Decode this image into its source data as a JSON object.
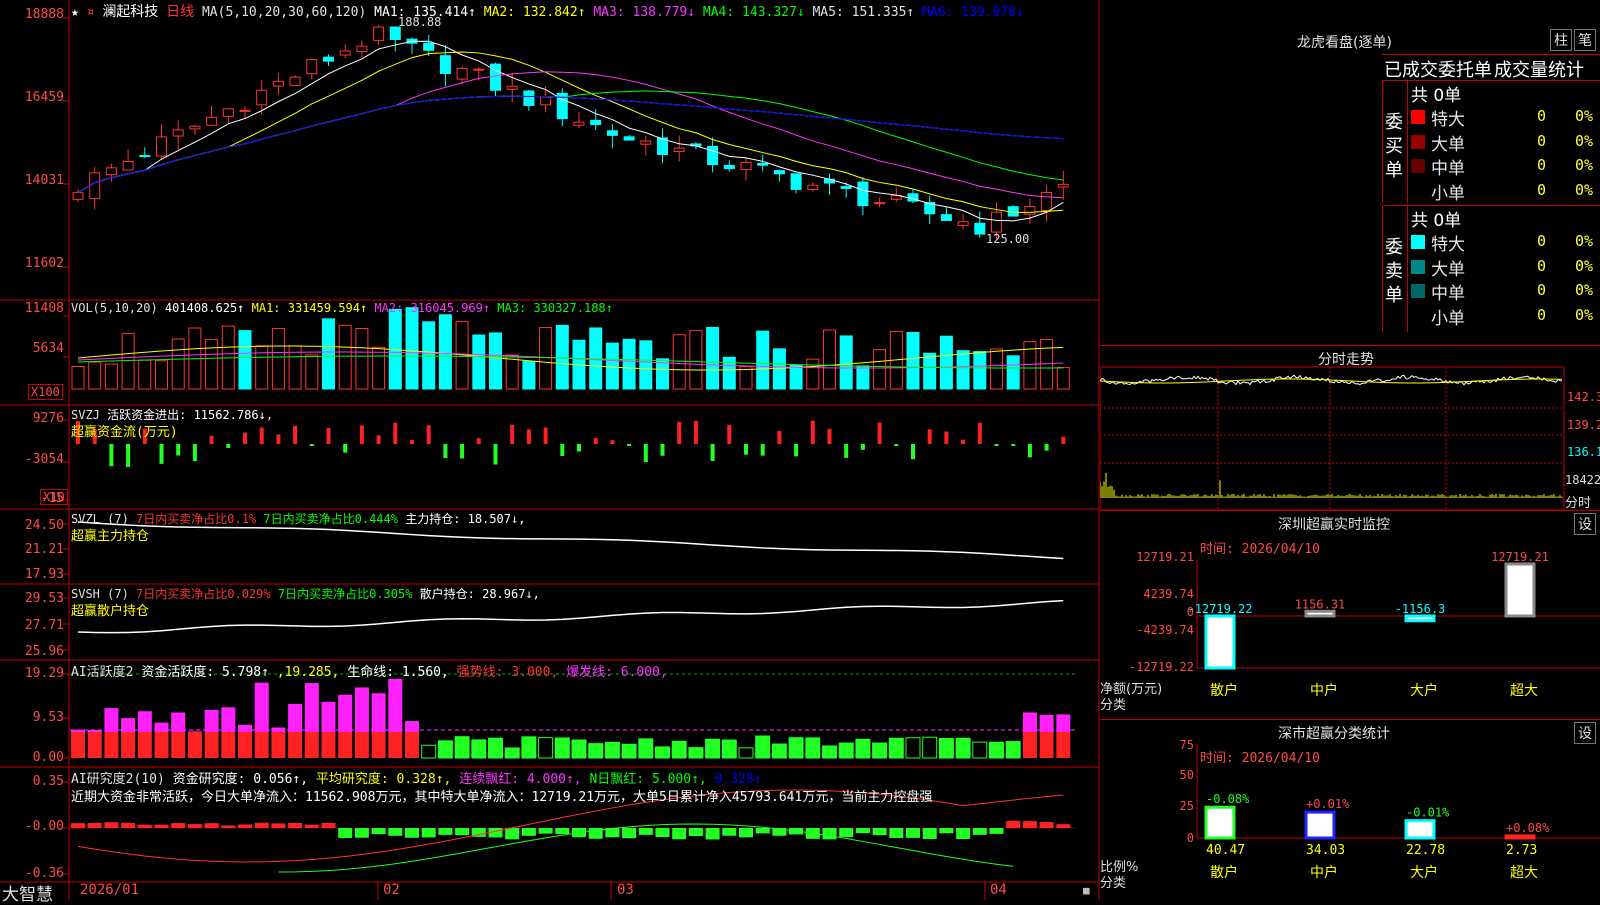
{
  "app": {
    "brand": "大智慧"
  },
  "stock": {
    "star": "★",
    "tag": "¤",
    "name": "澜起科技",
    "period": "日线"
  },
  "colors": {
    "up": "#ff3333",
    "down": "#00ffff",
    "frame": "#c00000",
    "ma1": "#ffffff",
    "ma2": "#ffff00",
    "ma3": "#ff33ff",
    "ma4": "#00ff00",
    "ma5": "#c8c8c8",
    "ma6": "#0000ff"
  },
  "main_panel": {
    "ma_label": "MA(5,10,20,30,60,120)",
    "ma_items": [
      {
        "text": "MA1: 135.414↑",
        "color": "#ffffff"
      },
      {
        "text": "MA2: 132.842↑",
        "color": "#ffff00"
      },
      {
        "text": "MA3: 138.779↓",
        "color": "#ff33ff"
      },
      {
        "text": "MA4: 143.327↓",
        "color": "#00ff00"
      },
      {
        "text": "MA5: 151.335↑",
        "color": "#e0e0e0"
      },
      {
        "text": "MA6: 139.078↓",
        "color": "#0000ff"
      }
    ],
    "y_ticks": [
      "18888",
      "16459",
      "14031",
      "11602"
    ],
    "high_label": "188.88",
    "low_label": "125.00"
  },
  "vol_panel": {
    "header": [
      {
        "text": "VOL(5,10,20)",
        "color": "#e0e0e0"
      },
      {
        "text": "401408.625↑",
        "color": "#ffffff"
      },
      {
        "text": "MA1: 331459.594↑",
        "color": "#ffff00"
      },
      {
        "text": "MA2: 316045.969↑",
        "color": "#ff33ff"
      },
      {
        "text": "MA3: 330327.188↑",
        "color": "#00ff00"
      }
    ],
    "y_ticks": [
      "11408",
      "5634"
    ],
    "unit": "X100"
  },
  "svzj_panel": {
    "header": [
      {
        "text": "SVZJ",
        "color": "#e0e0e0"
      },
      {
        "text": "活跃资金进出: 11562.786↓,",
        "color": "#ffffff"
      }
    ],
    "subtitle": "超赢资金流(万元)",
    "y_ticks": [
      "9276",
      "-3054",
      "-15"
    ],
    "unit": "X10"
  },
  "svzl_panel": {
    "header": [
      {
        "text": "SVZL (7)",
        "color": "#e0e0e0"
      },
      {
        "text": "7日内买卖净占比0.1%",
        "color": "#ff3333"
      },
      {
        "text": "7日内买卖净占比0.444%",
        "color": "#00ff00"
      },
      {
        "text": "主力持仓: 18.507↓,",
        "color": "#ffffff"
      }
    ],
    "subtitle": "超赢主力持仓",
    "y_ticks": [
      "24.50",
      "21.21",
      "17.93"
    ]
  },
  "svsh_panel": {
    "header": [
      {
        "text": "SVSH (7)",
        "color": "#e0e0e0"
      },
      {
        "text": "7日内买卖净占比0.029%",
        "color": "#ff3333"
      },
      {
        "text": "7日内买卖净占比0.305%",
        "color": "#00ff00"
      },
      {
        "text": "散户持仓: 28.967↓,",
        "color": "#ffffff"
      }
    ],
    "subtitle": "超赢散户持仓",
    "y_ticks": [
      "29.53",
      "27.71",
      "25.96"
    ]
  },
  "ai_active_panel": {
    "header": [
      {
        "text": "AI活跃度2",
        "color": "#e0e0e0"
      },
      {
        "text": "资金活跃度: 5.798↑",
        "color": "#ffffff"
      },
      {
        "text": ",19.285,",
        "color": "#ffff00"
      },
      {
        "text": "生命线: 1.560,",
        "color": "#ffffff"
      },
      {
        "text": "强势线: 3.000,",
        "color": "#ff3333"
      },
      {
        "text": "爆发线: 6.000,",
        "color": "#ff33ff"
      }
    ],
    "y_ticks": [
      "19.29",
      "9.53",
      "0.00"
    ]
  },
  "ai_research_panel": {
    "header": [
      {
        "text": "AI研究度2(10)",
        "color": "#e0e0e0"
      },
      {
        "text": "资金研究度: 0.056↑,",
        "color": "#ffffff"
      },
      {
        "text": "平均研究度: 0.328↑,",
        "color": "#ffff00"
      },
      {
        "text": "连续飘红: 4.000↑,",
        "color": "#ff33ff"
      },
      {
        "text": "N日飘红: 5.000↑,",
        "color": "#00ff00"
      },
      {
        "text": "0.328↑",
        "color": "#0000ff"
      }
    ],
    "note": "近期大资金非常活跃，今日大单净流入：11562.908万元，其中特大单净流入：12719.21万元，大单5日累计净入45793.641万元，当前主力控盘强",
    "y_ticks": [
      "0.35",
      "-0.00",
      "-0.36"
    ]
  },
  "x_axis": {
    "labels": [
      "2026/01",
      "02",
      "03",
      "04"
    ]
  },
  "longhu": {
    "title": "龙虎看盘(逐单)",
    "btn_zhu": "柱",
    "btn_bi": "笔",
    "tabs": [
      "已成交",
      "委托单",
      "成交量统计"
    ],
    "buy": {
      "side_label": "委买单",
      "total": "共 0单",
      "rows": [
        {
          "name": "特大",
          "count": "0",
          "pct": "0%",
          "color": "#ff0000"
        },
        {
          "name": "大单",
          "count": "0",
          "pct": "0%",
          "color": "#990000"
        },
        {
          "name": "中单",
          "count": "0",
          "pct": "0%",
          "color": "#660000"
        },
        {
          "name": "小单",
          "count": "0",
          "pct": "0%",
          "color": "#000000"
        }
      ]
    },
    "sell": {
      "side_label": "委卖单",
      "total": "共 0单",
      "rows": [
        {
          "name": "特大",
          "count": "0",
          "pct": "0%",
          "color": "#00ffff"
        },
        {
          "name": "大单",
          "count": "0",
          "pct": "0%",
          "color": "#008888"
        },
        {
          "name": "中单",
          "count": "0",
          "pct": "0%",
          "color": "#006666"
        },
        {
          "name": "小单",
          "count": "0",
          "pct": "0%",
          "color": "#000000"
        }
      ]
    }
  },
  "intraday": {
    "title": "分时走势",
    "prices": [
      "142.3",
      "139.2",
      "136.1"
    ],
    "volume_label": "18422",
    "suffix": "分时"
  },
  "sz_monitor": {
    "title": "深圳超赢实时监控",
    "btn": "设",
    "time": "时间: 2026/04/10",
    "y_ticks": [
      "12719.21",
      "4239.74",
      "0",
      "-4239.74",
      "-12719.22"
    ],
    "ylabel": "净额(万元)",
    "xlabel": "分类",
    "chart_data": {
      "type": "bar",
      "categories": [
        "散户",
        "中户",
        "大户",
        "超大"
      ],
      "values": [
        -12719.22,
        1156.31,
        -1156.3,
        12719.21
      ],
      "value_labels": [
        "-12719.22",
        "1156.31",
        "-1156.3",
        "12719.21"
      ],
      "ylim": [
        -12719.22,
        12719.21
      ]
    }
  },
  "sz_class": {
    "title": "深市超赢分类统计",
    "btn": "设",
    "time": "时间: 2026/04/10",
    "y_ticks": [
      "75",
      "50",
      "25",
      "0"
    ],
    "ylabel": "比例%",
    "xlabel": "分类",
    "chart_data": {
      "type": "bar",
      "categories": [
        "散户",
        "中户",
        "大户",
        "超大"
      ],
      "values": [
        40.47,
        34.03,
        22.78,
        2.73
      ],
      "changes": [
        "-0.08%",
        "+0.01%",
        "-0.01%",
        "+0.08%"
      ],
      "value_labels": [
        "40.47",
        "34.03",
        "22.78",
        "2.73"
      ],
      "ylim": [
        0,
        75
      ]
    }
  }
}
